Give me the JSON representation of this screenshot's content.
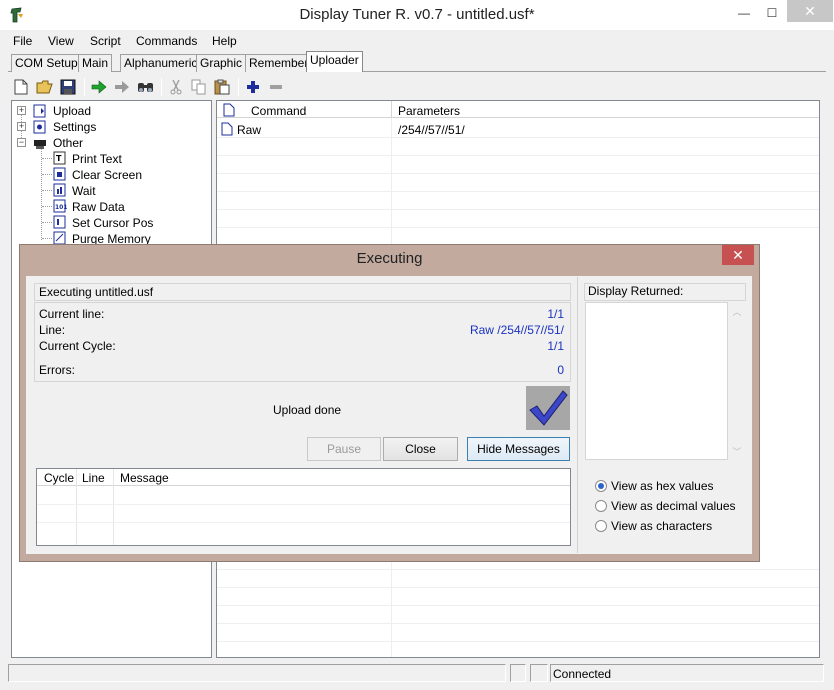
{
  "window": {
    "title": "Display Tuner R. v0.7 - untitled.usf*",
    "minimize_glyph": "—",
    "maximize_glyph": "☐",
    "close_glyph": "✕"
  },
  "menu": [
    "File",
    "View",
    "Script",
    "Commands",
    "Help"
  ],
  "tabs": [
    "COM Setup",
    "Main",
    "Alphanumeric",
    "Graphic",
    "Remember",
    "Uploader"
  ],
  "active_tab": "Uploader",
  "toolbar": [
    "new-icon",
    "open-icon",
    "save-icon",
    "run-icon",
    "step-icon",
    "find-icon",
    "cut-icon",
    "copy-icon",
    "paste-icon",
    "add-icon",
    "remove-icon"
  ],
  "tree": {
    "roots": [
      {
        "label": "Upload",
        "expander": "+"
      },
      {
        "label": "Settings",
        "expander": "+"
      },
      {
        "label": "Other",
        "expander": "−"
      }
    ],
    "children": [
      "Print Text",
      "Clear Screen",
      "Wait",
      "Raw Data",
      "Set Cursor Pos",
      "Purge Memory"
    ]
  },
  "list": {
    "columns": [
      "Command",
      "Parameters"
    ],
    "rows": [
      {
        "command": "Raw",
        "parameters": "/254//57//51/"
      }
    ]
  },
  "status": {
    "connection": "Connected"
  },
  "dialog": {
    "title": "Executing",
    "close_glyph": "✕",
    "executing_label": "Executing untitled.usf",
    "current_line_label": "Current line:",
    "current_line_value": "1/1",
    "line_label": "Line:",
    "line_value": "Raw /254//57//51/",
    "current_cycle_label": "Current Cycle:",
    "current_cycle_value": "1/1",
    "errors_label": "Errors:",
    "errors_value": "0",
    "status_message": "Upload done",
    "buttons": {
      "pause": "Pause",
      "close": "Close",
      "hide_messages": "Hide Messages"
    },
    "message_columns": [
      "Cycle",
      "Line",
      "Message"
    ],
    "display_returned_label": "Display Returned:",
    "view_options": [
      {
        "label": "View as hex values",
        "checked": true
      },
      {
        "label": "View as decimal values",
        "checked": false
      },
      {
        "label": "View as characters",
        "checked": false
      }
    ]
  }
}
